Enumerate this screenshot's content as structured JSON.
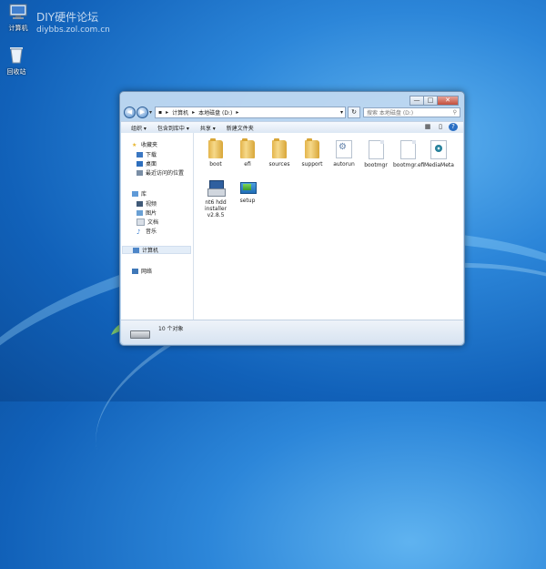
{
  "desktop": {
    "icons": [
      {
        "label": "计算机",
        "icon": "computer-icon"
      },
      {
        "label": "回收站",
        "icon": "recycle-bin-icon"
      }
    ],
    "watermark": {
      "line1": "DIY硬件论坛",
      "line2": "diybbs.zol.com.cn"
    }
  },
  "window": {
    "controls": {
      "minimize": "—",
      "maximize": "□",
      "close": "✕"
    },
    "address": {
      "crumbs": [
        "计算机",
        "本地磁盘 (D:)"
      ]
    },
    "search_placeholder": "搜索 本地磁盘 (D:)",
    "toolbar": [
      "组织 ▾",
      "包含到库中 ▾",
      "共享 ▾",
      "新建文件夹"
    ],
    "nav": {
      "favorites": {
        "label": "收藏夹",
        "items": [
          "下载",
          "桌面",
          "最近访问的位置"
        ]
      },
      "libraries": {
        "label": "库",
        "items": [
          "视频",
          "图片",
          "文档",
          "音乐"
        ]
      },
      "computer": "计算机",
      "network": "网络"
    },
    "files": [
      {
        "name": "boot",
        "type": "folder"
      },
      {
        "name": "efi",
        "type": "folder"
      },
      {
        "name": "sources",
        "type": "folder"
      },
      {
        "name": "support",
        "type": "folder"
      },
      {
        "name": "autorun",
        "type": "settings-file"
      },
      {
        "name": "bootmgr",
        "type": "file"
      },
      {
        "name": "bootmgr.efi",
        "type": "file"
      },
      {
        "name": "MediaMeta",
        "type": "media-file"
      },
      {
        "name": "nt6 hdd installer v2.8.5",
        "type": "installer"
      },
      {
        "name": "setup",
        "type": "setup"
      }
    ],
    "status": {
      "text": "10 个对象"
    }
  }
}
